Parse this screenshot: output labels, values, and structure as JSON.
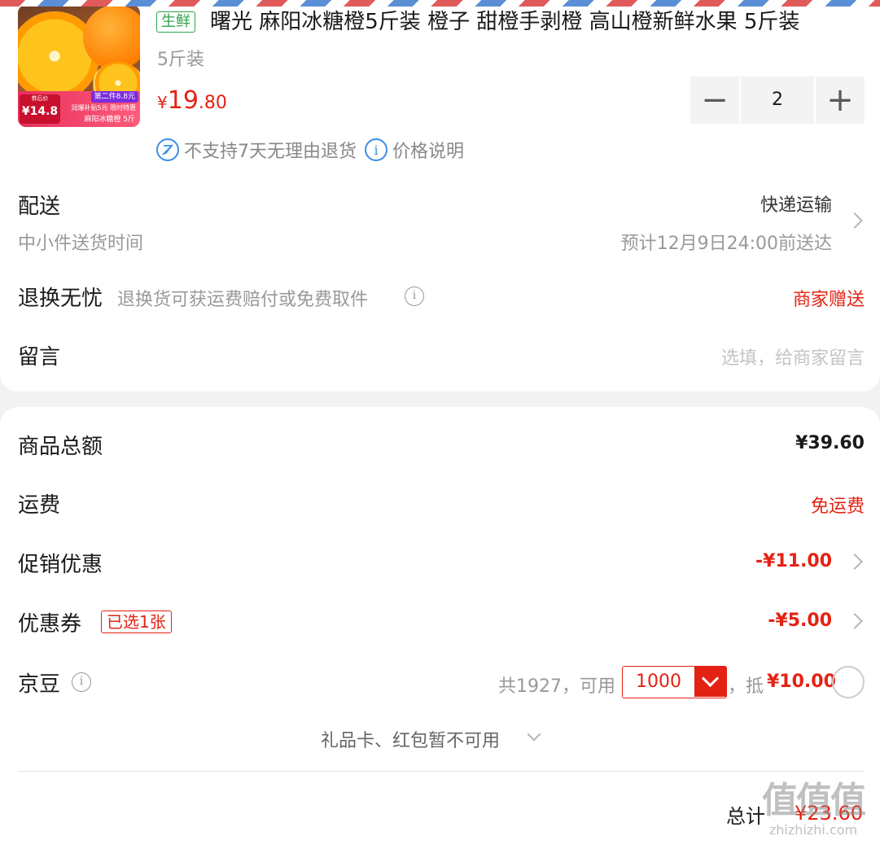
{
  "product": {
    "image_alt": "麻阳冰糖橙 orange product image",
    "image_texts": {
      "price_label": "券后价",
      "price_value": "¥14.8",
      "second_piece": "第二件8.8元",
      "promo": "润爆补贴5元 限时特惠",
      "name": "麻阳冰糖橙 5斤"
    },
    "fresh_tag": "生鲜",
    "title": "曙光 麻阳冰糖橙5斤装 橙子 甜橙手剥橙 高山橙新鲜水果 5斤装",
    "spec": "5斤装",
    "price_currency": "¥",
    "price_int": "19",
    "price_dec": ".80",
    "quantity": "2",
    "policy_no_return": "不支持7天无理由退货",
    "policy_price_desc": "价格说明"
  },
  "delivery": {
    "label": "配送",
    "method": "快递运输",
    "sub_label": "中小件送货时间",
    "eta": "预计12月9日24:00前送达"
  },
  "return_service": {
    "label": "退换无忧",
    "desc": "退换货可获运费赔付或免费取件",
    "value": "商家赠送"
  },
  "message": {
    "label": "留言",
    "placeholder": "选填，给商家留言"
  },
  "summary": {
    "goods_total_label": "商品总额",
    "goods_total_value": "¥39.60",
    "shipping_label": "运费",
    "shipping_value": "免运费",
    "promo_label": "促销优惠",
    "promo_value": "-¥11.00",
    "coupon_label": "优惠券",
    "coupon_badge": "已选1张",
    "coupon_value": "-¥5.00",
    "beans_label": "京豆",
    "beans_total": "共1927，可用",
    "beans_use_value": "1000",
    "beans_deduct_prefix": "，抵",
    "beans_deduct_value": "¥10.00",
    "giftcard_text": "礼品卡、红包暂不可用",
    "total_label": "总计",
    "total_value": "¥23.60"
  },
  "watermark": {
    "big": "值值值",
    "url": "zhizhizhi.com"
  },
  "colors": {
    "accent_red": "#e42213",
    "fresh_green": "#2ea34a",
    "info_blue": "#3b8ee6"
  }
}
